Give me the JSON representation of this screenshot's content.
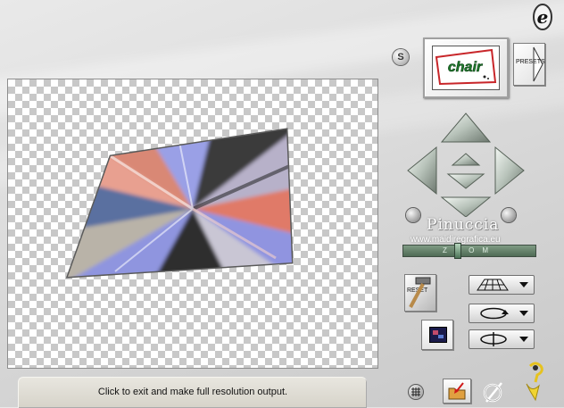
{
  "status_text": "Click to exit and make full resolution output.",
  "logo_letter": "e",
  "s_button_label": "S",
  "preset_thumbnail_text": "chair",
  "presets_label": "PRESETS",
  "reset_label": "RESET",
  "watermark": {
    "name": "Pinuccia",
    "url": "www.maidiregrafica.eu"
  },
  "zoom": {
    "label": "ZOOM",
    "level": 0.41
  },
  "colors": {
    "panel_bg": "#dcdcdc",
    "status_bg": "#d6d3c9",
    "checker_dark": "#c8c8c8",
    "zoom_bar": "#5f7d66",
    "preset_red": "#c8262a",
    "preset_green": "#1f7a2c"
  },
  "icons": [
    "logo-e-icon",
    "arrow-up-icon",
    "arrow-down-icon",
    "arrow-left-icon",
    "arrow-right-icon",
    "move-up-small-icon",
    "move-down-small-icon",
    "hammer-icon",
    "perspective-grid-icon",
    "rotate-icon",
    "flip-icon",
    "grid-icon",
    "open-folder-icon",
    "no-cancel-icon",
    "help-figure-icon"
  ]
}
